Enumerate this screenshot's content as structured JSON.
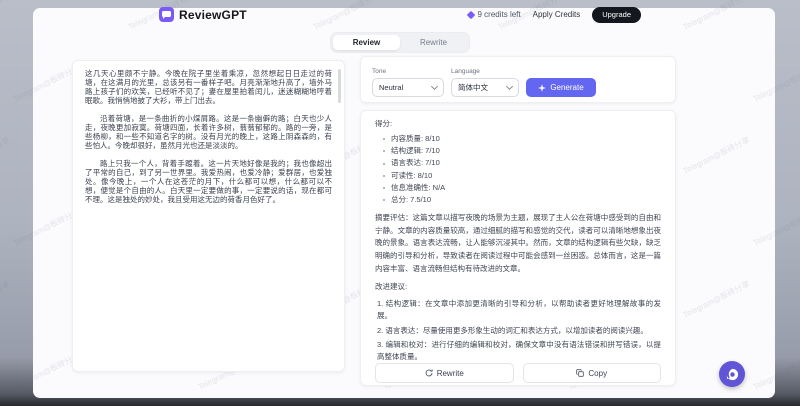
{
  "header": {
    "logo_text": "ReviewGPT",
    "credits_text": "9 credits left",
    "apply_credits_label": "Apply Credits",
    "upgrade_label": "Upgrade"
  },
  "tabs": {
    "review_label": "Review",
    "rewrite_label": "Rewrite"
  },
  "editor": {
    "paragraphs": [
      "这几天心里颇不宁静。今晚在院子里坐着乘凉，忽然想起日日走过的荷塘，在这满月的光里，总该另有一番样子吧。月亮渐渐地升高了，墙外马路上孩子们的欢笑，已经听不见了；妻在屋里拍着闰儿，迷迷糊糊地哼着眠歌。我悄悄地披了大衫，带上门出去。",
      "沿着荷塘，是一条曲折的小煤屑路。这是一条幽僻的路；白天也少人走，夜晚更加寂寞。荷塘四面，长着许多树，蓊蓊郁郁的。路的一旁，是些杨柳，和一些不知道名字的树。没有月光的晚上，这路上阴森森的，有些怕人。今晚却很好，虽然月光也还是淡淡的。",
      "路上只我一个人，背着手踱着。这一片天地好像是我的；我也像超出了平常的自己，到了另一世界里。我爱热闹，也爱冷静；爱群居，也爱独处。像今晚上，一个人在这苍茫的月下，什么都可以想，什么都可以不想，便觉是个自由的人。白天里一定要做的事，一定要说的话，现在都可不理。这是独处的妙处，我且受用这无边的荷香月色好了。"
    ]
  },
  "controls": {
    "tone_label": "Tone",
    "tone_value": "Neutral",
    "language_label": "Language",
    "language_value": "简体中文",
    "generate_label": "Generate"
  },
  "results": {
    "score_heading": "得分:",
    "scores": [
      {
        "label": "内容质量",
        "value": "8/10"
      },
      {
        "label": "结构逻辑",
        "value": "7/10"
      },
      {
        "label": "语言表达",
        "value": "7/10"
      },
      {
        "label": "可读性",
        "value": "8/10"
      },
      {
        "label": "信息准确性",
        "value": "N/A"
      },
      {
        "label": "总分",
        "value": "7.5/10"
      }
    ],
    "summary_label": "摘要评估",
    "summary_text": "这篇文章以描写夜晚的场景为主题，展现了主人公在荷塘中感受到的自由和宁静。文章的内容质量较高，通过细腻的描写和感觉的交代，读者可以清晰地想象出夜晚的景象。语言表达流畅，让人能够沉浸其中。然而，文章的结构逻辑有些欠缺，缺乏明确的引导和分析，导致读者在阅读过程中可能会感到一丝困惑。总体而言，这是一篇内容丰富、语言流畅但结构有待改进的文章。",
    "suggestions_heading": "改进建议:",
    "suggestions": [
      {
        "label": "结构逻辑",
        "text": "在文章中添加更清晰的引导和分析，以帮助读者更好地理解故事的发展。"
      },
      {
        "label": "语言表达",
        "text": "尽量使用更多形象生动的词汇和表达方式，以增加读者的阅读兴趣。"
      },
      {
        "label": "编辑和校对",
        "text": "进行仔细的编辑和校对，确保文章中没有语法错误和拼写错误，以提高整体质量。"
      }
    ],
    "rewrite_label": "Rewrite",
    "copy_label": "Copy"
  },
  "watermark": {
    "text": "Telegram@板砖分享"
  },
  "colors": {
    "brand": "#7a5af8",
    "primary": "#6366f1",
    "upgrade_bg": "#15171e",
    "canvas": "#fbfbfd"
  }
}
